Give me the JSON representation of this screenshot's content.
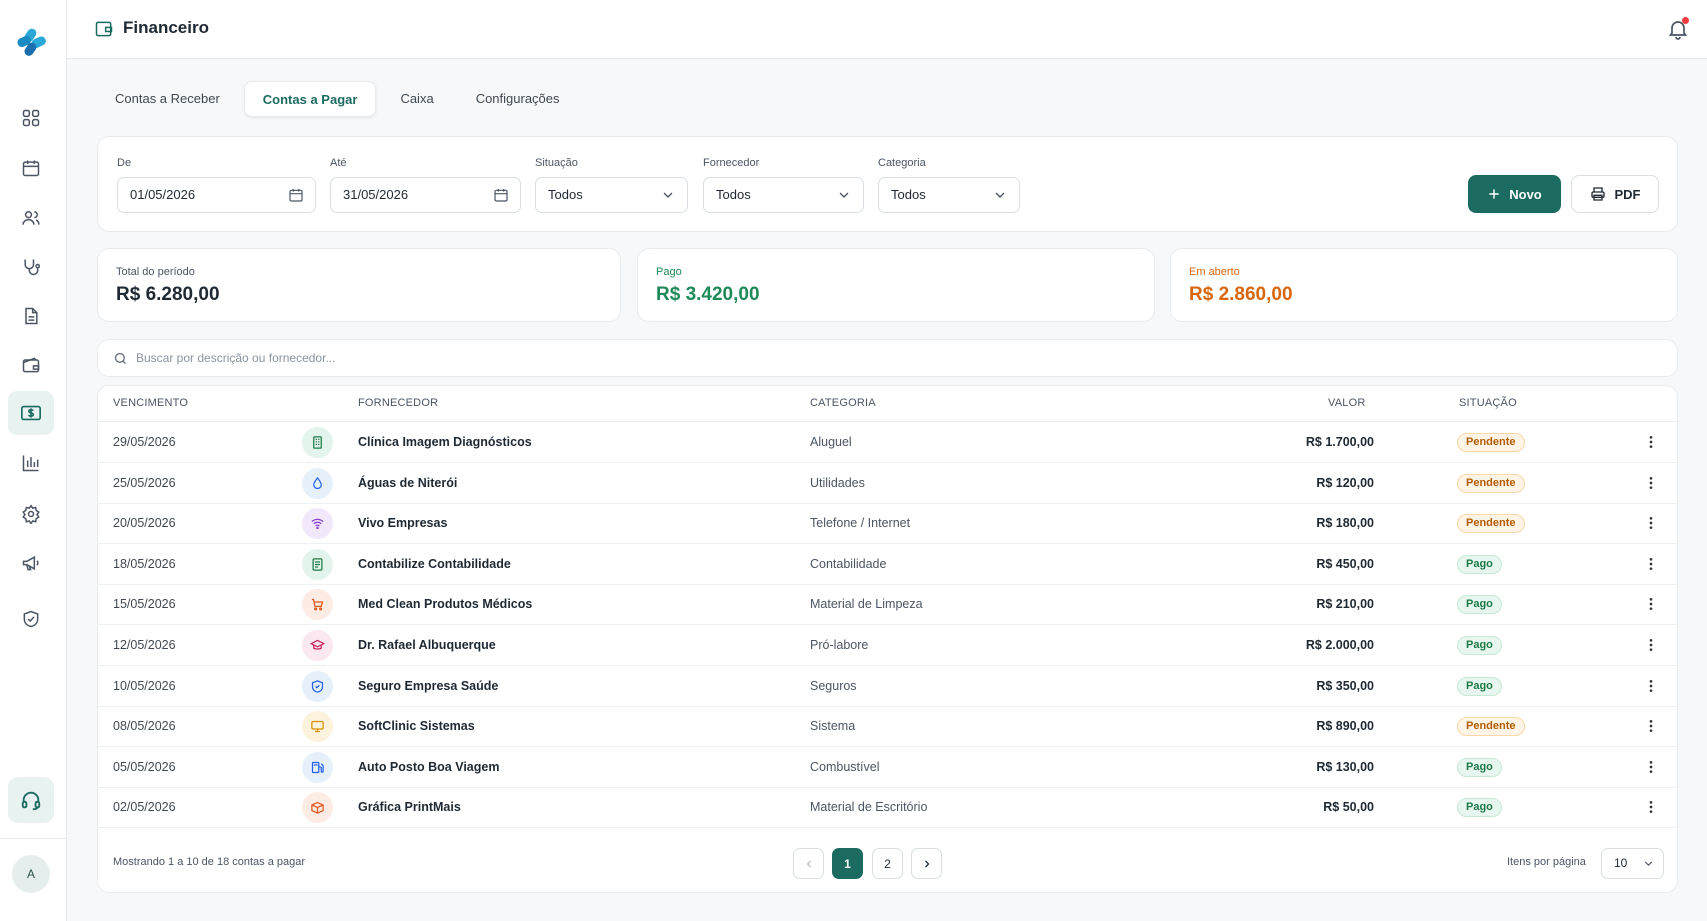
{
  "app": {
    "title": "Financeiro",
    "avatar_initial": "A"
  },
  "sidebar": {
    "items": [
      {
        "icon": "grid-icon"
      },
      {
        "icon": "calendar-icon"
      },
      {
        "icon": "users-icon"
      },
      {
        "icon": "stethoscope-icon"
      },
      {
        "icon": "document-icon"
      },
      {
        "icon": "wallet-icon"
      },
      {
        "icon": "money-icon",
        "active": true
      },
      {
        "icon": "bar-chart-icon"
      },
      {
        "icon": "gear-icon"
      },
      {
        "icon": "megaphone-icon"
      },
      {
        "icon": "shield-icon"
      }
    ],
    "support_icon": "headset-icon"
  },
  "tabs": [
    {
      "label": "Contas a Receber"
    },
    {
      "label": "Contas a Pagar",
      "active": true
    },
    {
      "label": "Caixa"
    },
    {
      "label": "Configurações"
    }
  ],
  "filters": {
    "from_label": "De",
    "from_value": "01/05/2026",
    "to_label": "Até",
    "to_value": "31/05/2026",
    "status_label": "Situação",
    "status_value": "Todos",
    "supplier_label": "Fornecedor",
    "supplier_value": "Todos",
    "category_label": "Categoria",
    "category_value": "Todos",
    "new_button": "Novo",
    "pdf_button": "PDF"
  },
  "summary": {
    "total_label": "Total do período",
    "total_value": "R$ 6.280,00",
    "paid_label": "Pago",
    "paid_value": "R$ 3.420,00",
    "open_label": "Em aberto",
    "open_value": "R$ 2.860,00",
    "colors": {
      "paid": "#1d8a57",
      "open": "#d9660f"
    }
  },
  "search": {
    "placeholder": "Buscar por descrição ou fornecedor..."
  },
  "table": {
    "headers": {
      "due": "VENCIMENTO",
      "supplier": "FORNECEDOR",
      "category": "CATEGORIA",
      "value": "VALOR",
      "status": "SITUAÇÃO"
    },
    "rows": [
      {
        "date": "29/05/2026",
        "supplier": "Clínica Imagem Diagnósticos",
        "icon": "building-icon",
        "category": "Aluguel",
        "value": "R$ 1.700,00",
        "status": "Pendente"
      },
      {
        "date": "25/05/2026",
        "supplier": "Águas de Niterói",
        "icon": "droplet-icon",
        "category": "Utilidades",
        "value": "R$ 120,00",
        "status": "Pendente"
      },
      {
        "date": "20/05/2026",
        "supplier": "Vivo Empresas",
        "icon": "wifi-icon",
        "category": "Telefone / Internet",
        "value": "R$ 180,00",
        "status": "Pendente"
      },
      {
        "date": "18/05/2026",
        "supplier": "Contabilize Contabilidade",
        "icon": "receipt-icon",
        "category": "Contabilidade",
        "value": "R$ 450,00",
        "status": "Pago"
      },
      {
        "date": "15/05/2026",
        "supplier": "Med Clean Produtos Médicos",
        "icon": "cart-icon",
        "category": "Material de Limpeza",
        "value": "R$ 210,00",
        "status": "Pago"
      },
      {
        "date": "12/05/2026",
        "supplier": "Dr. Rafael Albuquerque",
        "icon": "graduation-cap-icon",
        "category": "Pró-labore",
        "value": "R$ 2.000,00",
        "status": "Pago"
      },
      {
        "date": "10/05/2026",
        "supplier": "Seguro Empresa Saúde",
        "icon": "shield-icon",
        "category": "Seguros",
        "value": "R$ 350,00",
        "status": "Pago"
      },
      {
        "date": "08/05/2026",
        "supplier": "SoftClinic Sistemas",
        "icon": "monitor-icon",
        "category": "Sistema",
        "value": "R$ 890,00",
        "status": "Pendente"
      },
      {
        "date": "05/05/2026",
        "supplier": "Auto Posto Boa Viagem",
        "icon": "fuel-icon",
        "category": "Combustível",
        "value": "R$ 130,00",
        "status": "Pago"
      },
      {
        "date": "02/05/2026",
        "supplier": "Gráfica PrintMais",
        "icon": "box-icon",
        "category": "Material de Escritório",
        "value": "R$ 50,00",
        "status": "Pago"
      }
    ]
  },
  "pagination": {
    "summary": "Mostrando 1 a 10 de 18 contas a pagar",
    "pages": [
      "1",
      "2"
    ],
    "current": "1",
    "per_page_label": "Itens por página",
    "per_page_value": "10"
  },
  "colors": {
    "accent": "#1b6b61",
    "notification": "#ef3d3d"
  }
}
